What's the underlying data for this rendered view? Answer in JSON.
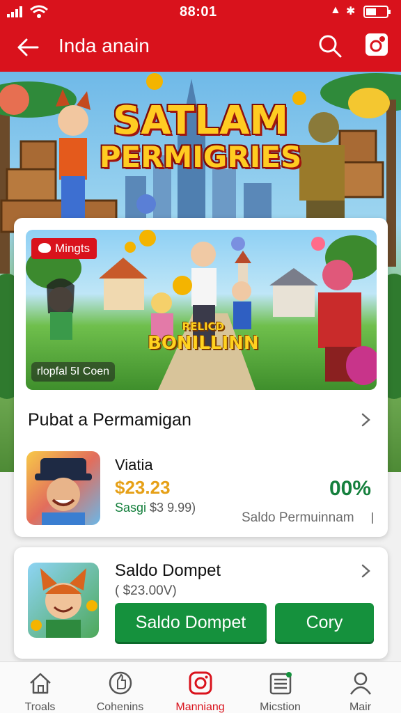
{
  "status_bar": {
    "time": "88:01"
  },
  "app_bar": {
    "title": "Inda anain"
  },
  "hero": {
    "title_line1": "SATLAM",
    "title_line2": "PERMIGRIES"
  },
  "promo": {
    "tag": "Mingts",
    "bonus_small": "RELICD",
    "bonus_big": "BONILLINN",
    "caption": "rlopfal 5I Coen"
  },
  "section": {
    "title": "Pubat a Permamigan"
  },
  "item1": {
    "name": "Viatia",
    "amount": "$23.23",
    "sub_label": "Sasgi",
    "sub_value": "$3 9.99)",
    "percent": "00%",
    "saldo_label": "Saldo Permuinnam"
  },
  "item2": {
    "name": "Saldo Dompet",
    "amount": "( $23.00V)",
    "btn_primary": "Saldo Dompet",
    "btn_secondary": "Cory"
  },
  "nav": [
    {
      "label": "Troals",
      "icon": "home-icon"
    },
    {
      "label": "Cohenins",
      "icon": "thumbs-up-icon"
    },
    {
      "label": "Manniang",
      "icon": "instagram-icon",
      "active": true
    },
    {
      "label": "Micstion",
      "icon": "list-icon"
    },
    {
      "label": "Mair",
      "icon": "user-icon"
    }
  ],
  "colors": {
    "brand_red": "#d9121c",
    "green": "#15913d",
    "gold": "#e6a017"
  }
}
